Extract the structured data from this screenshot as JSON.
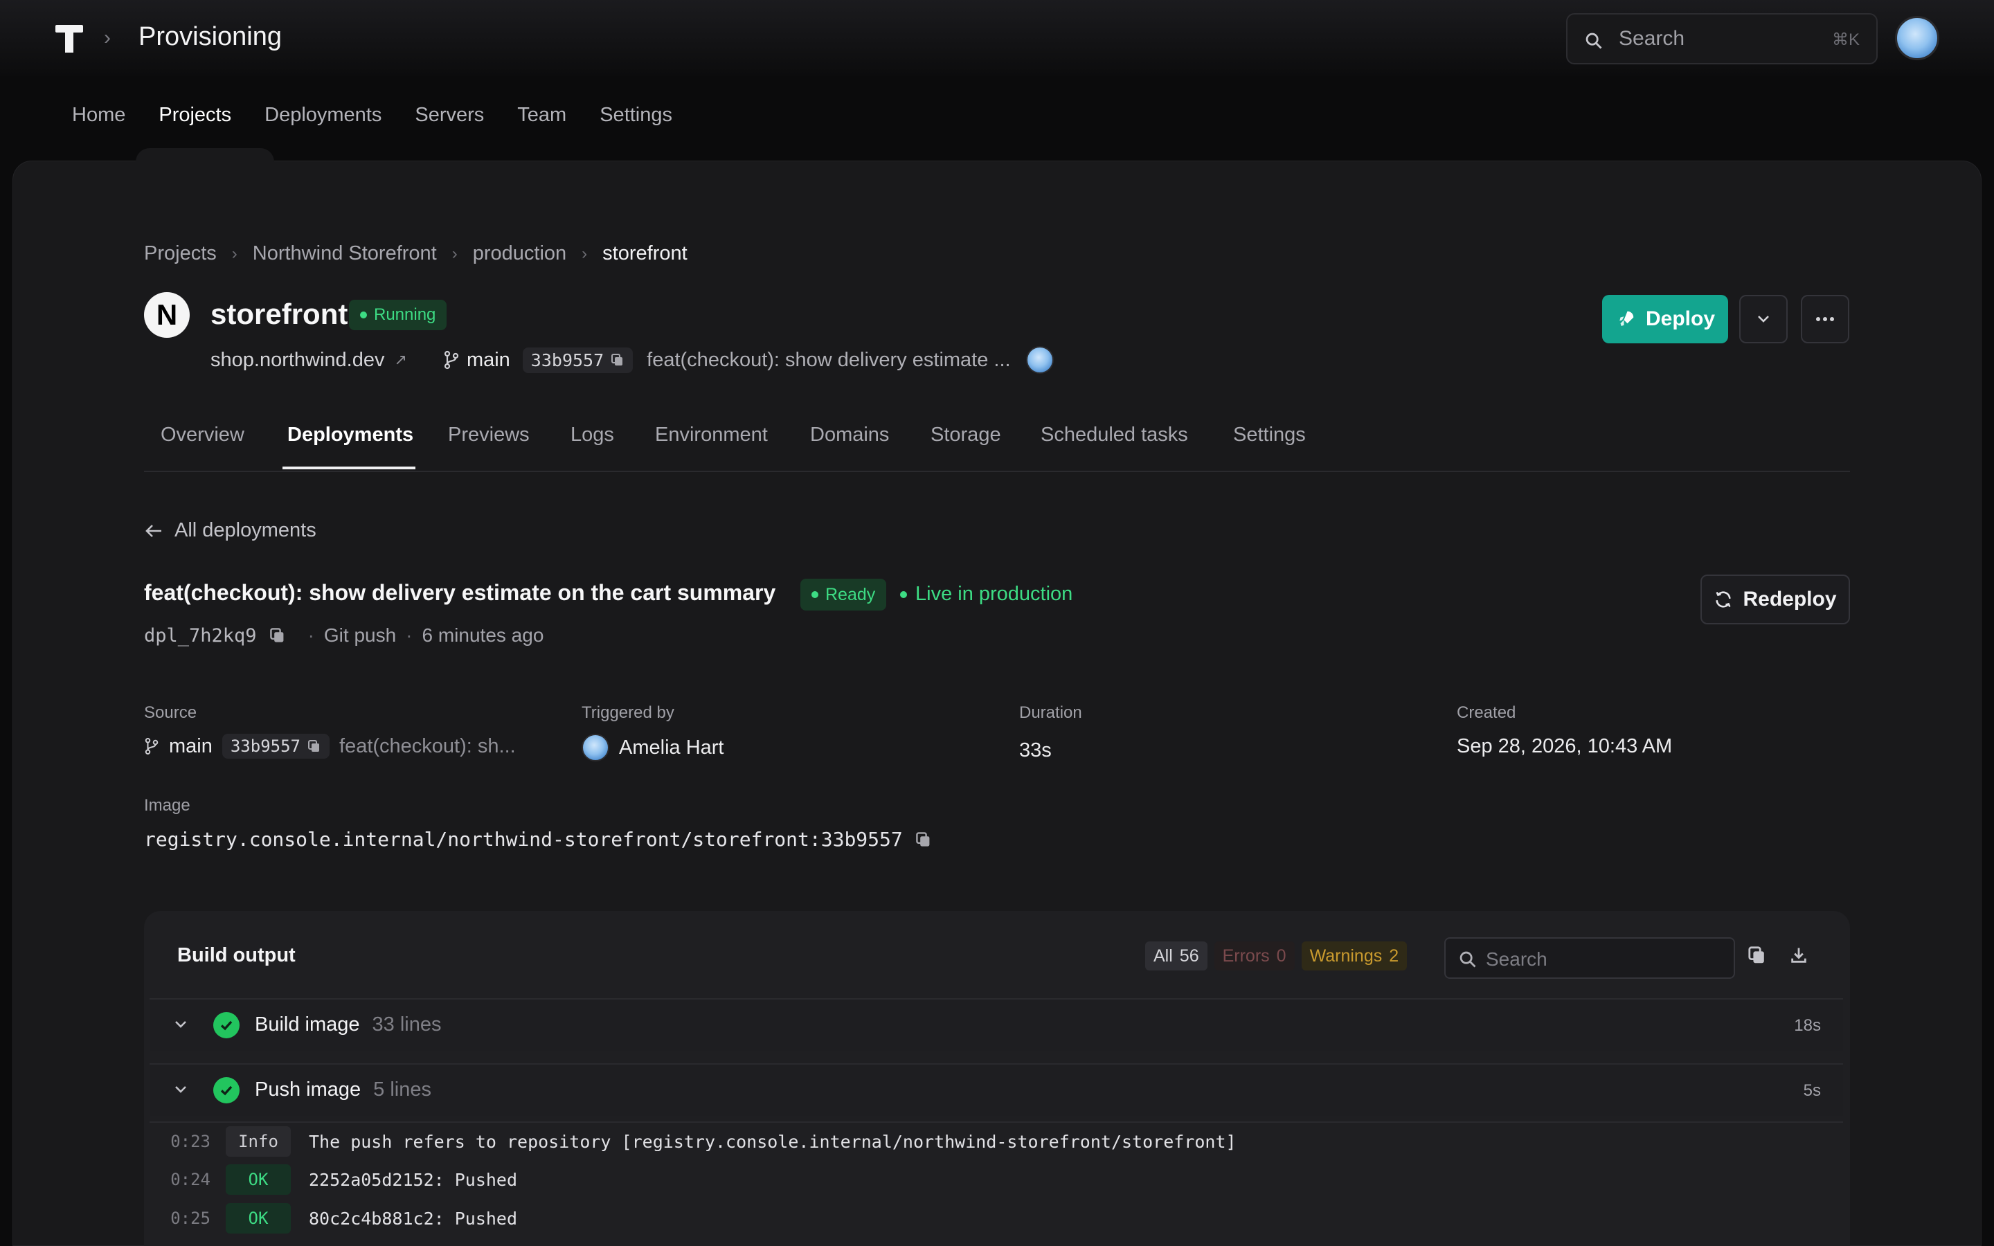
{
  "topbar": {
    "title": "Provisioning",
    "search_placeholder": "Search",
    "search_shortcut": "⌘K"
  },
  "nav": [
    "Home",
    "Projects",
    "Deployments",
    "Servers",
    "Team",
    "Settings"
  ],
  "nav_active": "Projects",
  "breadcrumb": [
    "Projects",
    "Northwind Storefront",
    "production",
    "storefront"
  ],
  "app": {
    "logo_letter": "N",
    "name": "storefront",
    "status": "Running",
    "domain": "shop.northwind.dev",
    "branch": "main",
    "commit": "33b9557",
    "commit_message": "feat(checkout): show delivery estimate ..."
  },
  "actions": {
    "deploy": "Deploy"
  },
  "tabs": [
    "Overview",
    "Deployments",
    "Previews",
    "Logs",
    "Environment",
    "Domains",
    "Storage",
    "Scheduled tasks",
    "Settings"
  ],
  "tab_active": "Deployments",
  "back_link": "All deployments",
  "deployment": {
    "title": "feat(checkout): show delivery estimate on the cart summary",
    "status": "Ready",
    "live_label": "Live in production",
    "id": "dpl_7h2kq9",
    "trigger": "Git push",
    "age": "6 minutes ago",
    "redeploy": "Redeploy",
    "source_label": "Source",
    "source_branch": "main",
    "source_commit": "33b9557",
    "source_message": "feat(checkout): sh...",
    "triggered_label": "Triggered by",
    "triggered_by": "Amelia Hart",
    "duration_label": "Duration",
    "duration": "33s",
    "created_label": "Created",
    "created": "Sep 28, 2026, 10:43 AM",
    "image_label": "Image",
    "image": "registry.console.internal/northwind-storefront/storefront:33b9557"
  },
  "build": {
    "title": "Build output",
    "filters": {
      "all_label": "All",
      "all_count": "56",
      "errors_label": "Errors",
      "errors_count": "0",
      "warnings_label": "Warnings",
      "warnings_count": "2"
    },
    "search_placeholder": "Search",
    "steps": [
      {
        "name": "Build image",
        "lines": "33 lines",
        "duration": "18s"
      },
      {
        "name": "Push image",
        "lines": "5 lines",
        "duration": "5s"
      }
    ],
    "logs": [
      {
        "time": "0:23",
        "level": "Info",
        "message": "The push refers to repository [registry.console.internal/northwind-storefront/storefront]"
      },
      {
        "time": "0:24",
        "level": "OK",
        "message": "2252a05d2152: Pushed"
      },
      {
        "time": "0:25",
        "level": "OK",
        "message": "80c2c4b881c2: Pushed"
      }
    ]
  },
  "colors": {
    "accent": "#13a58f",
    "success": "#3ddc84",
    "warning": "#c99a2e"
  }
}
